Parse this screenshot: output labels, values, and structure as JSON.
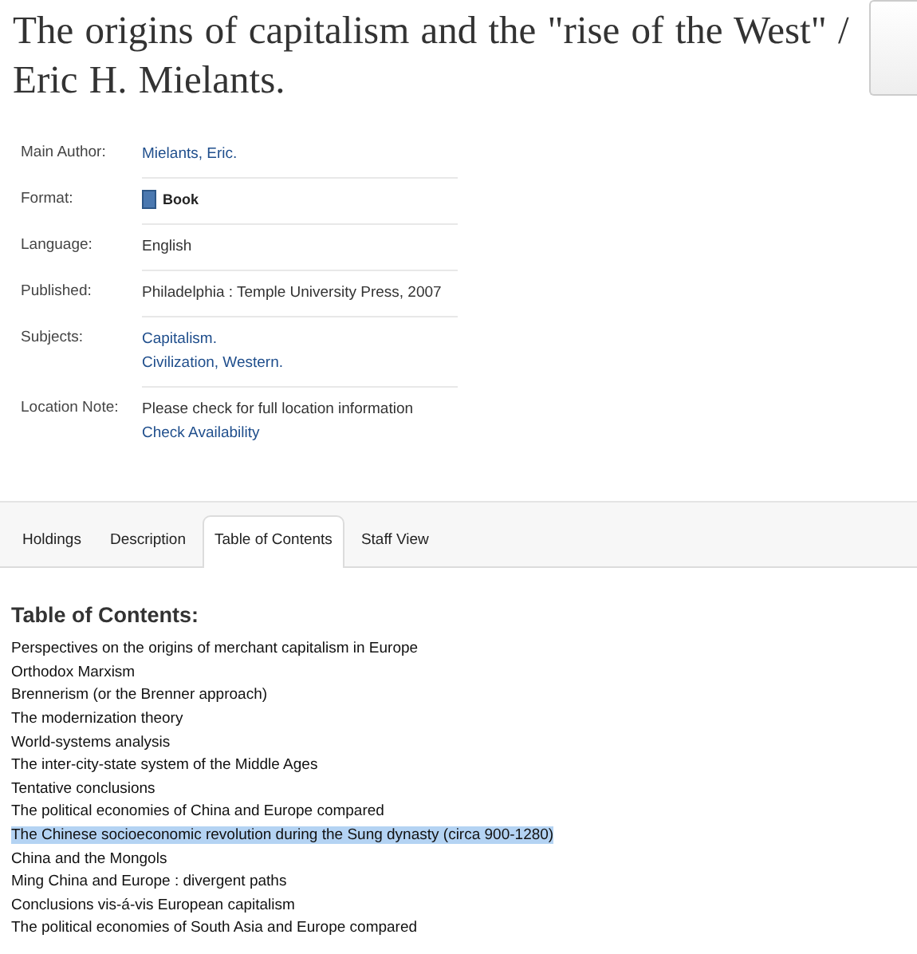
{
  "title": "The origins of capitalism and the \"rise of the West\" / Eric H. Mielants.",
  "details": [
    {
      "label": "Main Author:",
      "values": [
        {
          "kind": "link",
          "text": "Mielants, Eric."
        }
      ]
    },
    {
      "label": "Format:",
      "values": [
        {
          "kind": "format",
          "text": "Book"
        }
      ]
    },
    {
      "label": "Language:",
      "values": [
        {
          "kind": "text",
          "text": "English"
        }
      ]
    },
    {
      "label": "Published:",
      "values": [
        {
          "kind": "text",
          "text": "Philadelphia : Temple University Press, 2007"
        }
      ]
    },
    {
      "label": "Subjects:",
      "values": [
        {
          "kind": "link",
          "text": "Capitalism."
        },
        {
          "kind": "link",
          "text": "Civilization, Western."
        }
      ]
    },
    {
      "label": "Location Note:",
      "values": [
        {
          "kind": "text",
          "text": "Please check for full location information"
        },
        {
          "kind": "link",
          "text": "Check Availability"
        }
      ]
    }
  ],
  "tabs": [
    {
      "label": "Holdings",
      "selected": false
    },
    {
      "label": "Description",
      "selected": false
    },
    {
      "label": "Table of Contents",
      "selected": true
    },
    {
      "label": "Staff View",
      "selected": false
    }
  ],
  "contents_heading": "Table of Contents:",
  "contents": [
    {
      "text": "Perspectives on the origins of merchant capitalism in Europe",
      "selected": false
    },
    {
      "text": "Orthodox Marxism",
      "selected": false
    },
    {
      "text": "Brennerism (or the Brenner approach)",
      "selected": false
    },
    {
      "text": "The modernization theory",
      "selected": false
    },
    {
      "text": "World-systems analysis",
      "selected": false
    },
    {
      "text": "The inter-city-state system of the Middle Ages",
      "selected": false
    },
    {
      "text": "Tentative conclusions",
      "selected": false
    },
    {
      "text": "The political economies of China and Europe compared",
      "selected": false
    },
    {
      "text": "The Chinese socioeconomic revolution during the Sung dynasty (circa 900-1280)",
      "selected": true
    },
    {
      "text": "China and the Mongols",
      "selected": false
    },
    {
      "text": "Ming China and Europe : divergent paths",
      "selected": false
    },
    {
      "text": "Conclusions vis-á-vis European capitalism",
      "selected": false
    },
    {
      "text": "The political economies of South Asia and Europe compared",
      "selected": false
    }
  ]
}
